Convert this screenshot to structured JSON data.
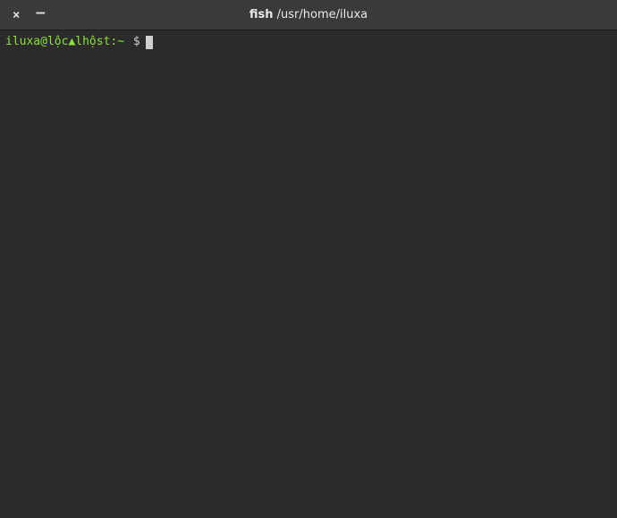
{
  "titlebar": {
    "app": "fish",
    "path": "/usr/home/iluxa",
    "close_symbol": "×",
    "minimize_symbol": "–"
  },
  "prompt": {
    "user_host": "iluxa@lộc▲lhộst:~",
    "symbol": "$"
  }
}
